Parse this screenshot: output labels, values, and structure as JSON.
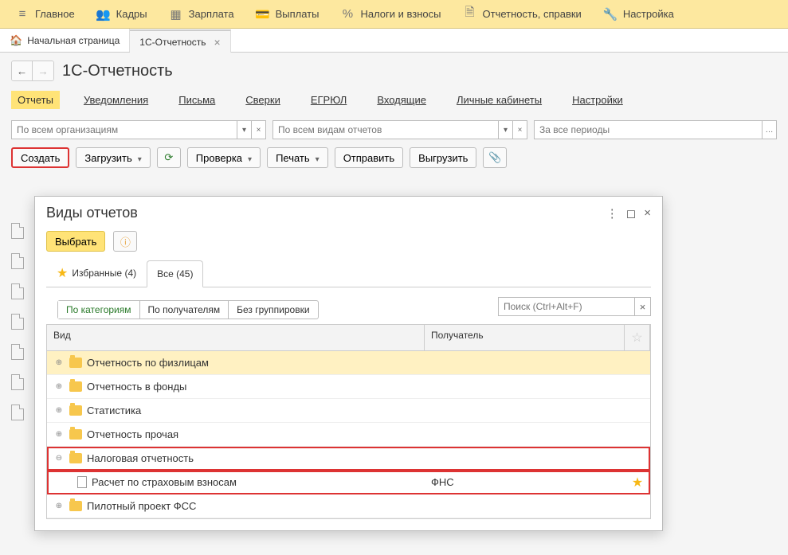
{
  "topmenu": [
    {
      "label": "Главное"
    },
    {
      "label": "Кадры"
    },
    {
      "label": "Зарплата"
    },
    {
      "label": "Выплаты"
    },
    {
      "label": "Налоги и взносы"
    },
    {
      "label": "Отчетность, справки"
    },
    {
      "label": "Настройка"
    }
  ],
  "tabs": {
    "home": "Начальная страница",
    "active": "1С-Отчетность"
  },
  "page": {
    "title": "1С-Отчетность"
  },
  "linktabs": [
    "Отчеты",
    "Уведомления",
    "Письма",
    "Сверки",
    "ЕГРЮЛ",
    "Входящие",
    "Личные кабинеты",
    "Настройки"
  ],
  "filters": {
    "org": "По всем организациям",
    "type": "По всем видам отчетов",
    "period": "За все периоды"
  },
  "toolbar": {
    "create": "Создать",
    "load": "Загрузить",
    "check": "Проверка",
    "print": "Печать",
    "send": "Отправить",
    "export": "Выгрузить"
  },
  "modal": {
    "title": "Виды отчетов",
    "choose": "Выбрать",
    "tabs": {
      "fav": "Избранные (4)",
      "all": "Все (45)"
    },
    "subtabs": [
      "По категориям",
      "По получателям",
      "Без группировки"
    ],
    "search_ph": "Поиск (Ctrl+Alt+F)",
    "headers": {
      "vid": "Вид",
      "rec": "Получатель"
    },
    "rows": [
      {
        "kind": "folder",
        "label": "Отчетность по физлицам",
        "selected": true
      },
      {
        "kind": "folder",
        "label": "Отчетность в фонды"
      },
      {
        "kind": "folder",
        "label": "Статистика"
      },
      {
        "kind": "folder",
        "label": "Отчетность прочая"
      },
      {
        "kind": "folder",
        "label": "Налоговая отчетность",
        "expanded": true,
        "boxed": true
      },
      {
        "kind": "doc",
        "label": "Расчет по страховым взносам",
        "recipient": "ФНС",
        "indent": 1,
        "boxed": true,
        "star": true
      },
      {
        "kind": "folder",
        "label": "Пилотный проект ФСС"
      }
    ]
  }
}
